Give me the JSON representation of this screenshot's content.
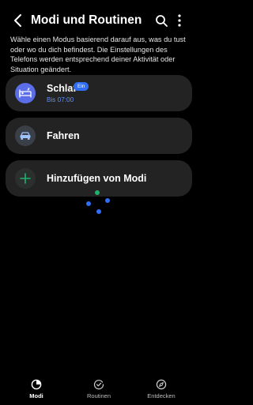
{
  "header": {
    "title": "Modi und Routinen"
  },
  "description": "Wähle einen Modus basierend darauf aus, was du tust oder wo du dich befindest. Die Einstellungen des Telefons werden entsprechend deiner Aktivität oder Situation geändert.",
  "modes": [
    {
      "label": "Schlaf",
      "badge": "Ein",
      "subtitle": "Bis 07:00",
      "icon": "bed-icon",
      "color": "#5b6ee8"
    },
    {
      "label": "Fahren",
      "icon": "car-icon",
      "color": "#3a3f48"
    },
    {
      "label": "Hinzufügen von Modi",
      "icon": "plus-icon",
      "color": "#1fb070"
    }
  ],
  "loader_colors": [
    "#1fb070",
    "#2f6ef5"
  ],
  "nav": [
    {
      "label": "Modi",
      "icon": "modes-icon",
      "active": true
    },
    {
      "label": "Routinen",
      "icon": "routines-icon",
      "active": false
    },
    {
      "label": "Entdecken",
      "icon": "compass-icon",
      "active": false
    }
  ]
}
